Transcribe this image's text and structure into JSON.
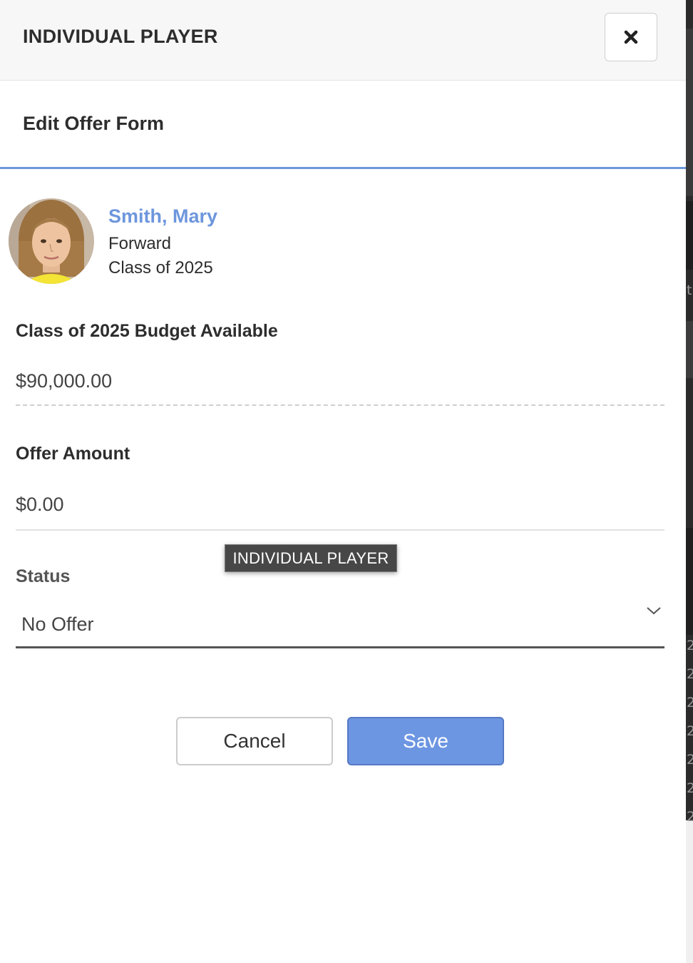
{
  "header": {
    "title": "INDIVIDUAL PLAYER",
    "close_icon": "close-x-icon"
  },
  "form": {
    "title": "Edit Offer Form"
  },
  "player": {
    "name": "Smith, Mary",
    "position": "Forward",
    "class_year": "Class of 2025"
  },
  "budget": {
    "label": "Class of 2025 Budget Available",
    "value": "$90,000.00"
  },
  "offer": {
    "label": "Offer Amount",
    "value": "$0.00"
  },
  "tooltip": {
    "text": "INDIVIDUAL PLAYER"
  },
  "status": {
    "label": "Status",
    "selected": "No Offer"
  },
  "actions": {
    "cancel_label": "Cancel",
    "save_label": "Save"
  },
  "colors": {
    "accent": "#6d96dc",
    "save_button": "#6d96e2",
    "header_bg": "#f7f7f7"
  },
  "background_edge": {
    "glyphs": [
      "t",
      "2",
      "2",
      "2",
      "2",
      "2",
      "2",
      "2"
    ]
  }
}
